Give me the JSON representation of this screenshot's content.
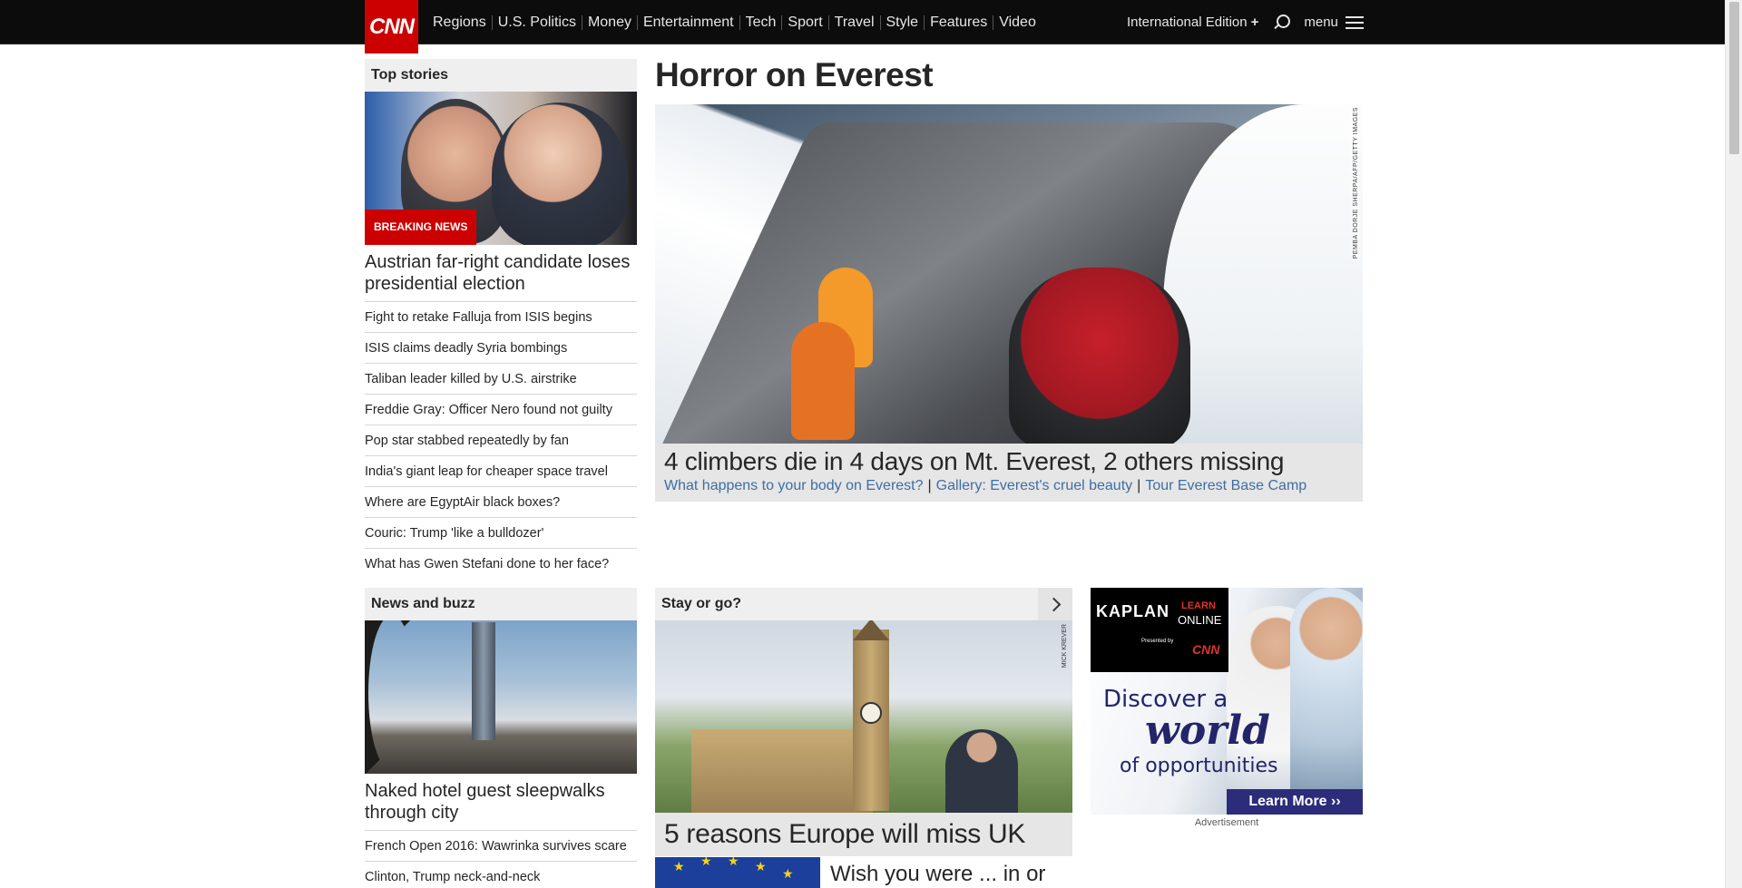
{
  "nav": {
    "logo": "CNN",
    "links": [
      "Regions",
      "U.S. Politics",
      "Money",
      "Entertainment",
      "Tech",
      "Sport",
      "Travel",
      "Style",
      "Features",
      "Video"
    ],
    "edition": "International Edition",
    "edition_plus": "+",
    "menu": "menu"
  },
  "top_stories": {
    "header": "Top stories",
    "badge": "BREAKING NEWS",
    "headline": "Austrian far-right candidate loses presidential election",
    "items": [
      "Fight to retake Falluja from ISIS begins",
      "ISIS claims deadly Syria bombings",
      "Taliban leader killed by U.S. airstrike",
      "Freddie Gray: Officer Nero found not guilty",
      "Pop star stabbed repeatedly by fan",
      "India's giant leap for cheaper space travel",
      "Where are EgyptAir black boxes?",
      "Couric: Trump 'like a bulldozer'",
      "What has Gwen Stefani done to her face?"
    ]
  },
  "feature": {
    "title": "Horror on Everest",
    "photo_credit": "PEMBA DORJE SHERPA/AFP/GETTY IMAGES",
    "headline": "4 climbers die in 4 days on Mt. Everest, 2 others missing",
    "related": [
      "What happens to your body on Everest?",
      "Gallery: Everest's cruel beauty",
      "Tour Everest Base Camp"
    ],
    "separator": "|"
  },
  "news_buzz": {
    "header": "News and buzz",
    "headline": "Naked hotel guest sleepwalks through city",
    "items": [
      "French Open 2016: Wawrinka survives scare",
      "Clinton, Trump neck-and-neck"
    ]
  },
  "stay_or_go": {
    "header": "Stay or go?",
    "photo_credit": "MICK KREVER",
    "headline": "5 reasons Europe will miss UK",
    "secondary": "Wish you were ... in or"
  },
  "ad": {
    "brand": "KAPLAN",
    "learn": "LEARN",
    "online": "ONLINE",
    "presented": "Presented by",
    "presented_brand": "CNN",
    "line1": "Discover a",
    "line2": "world",
    "line3": "of opportunities",
    "button": "Learn More ››",
    "label": "Advertisement"
  }
}
